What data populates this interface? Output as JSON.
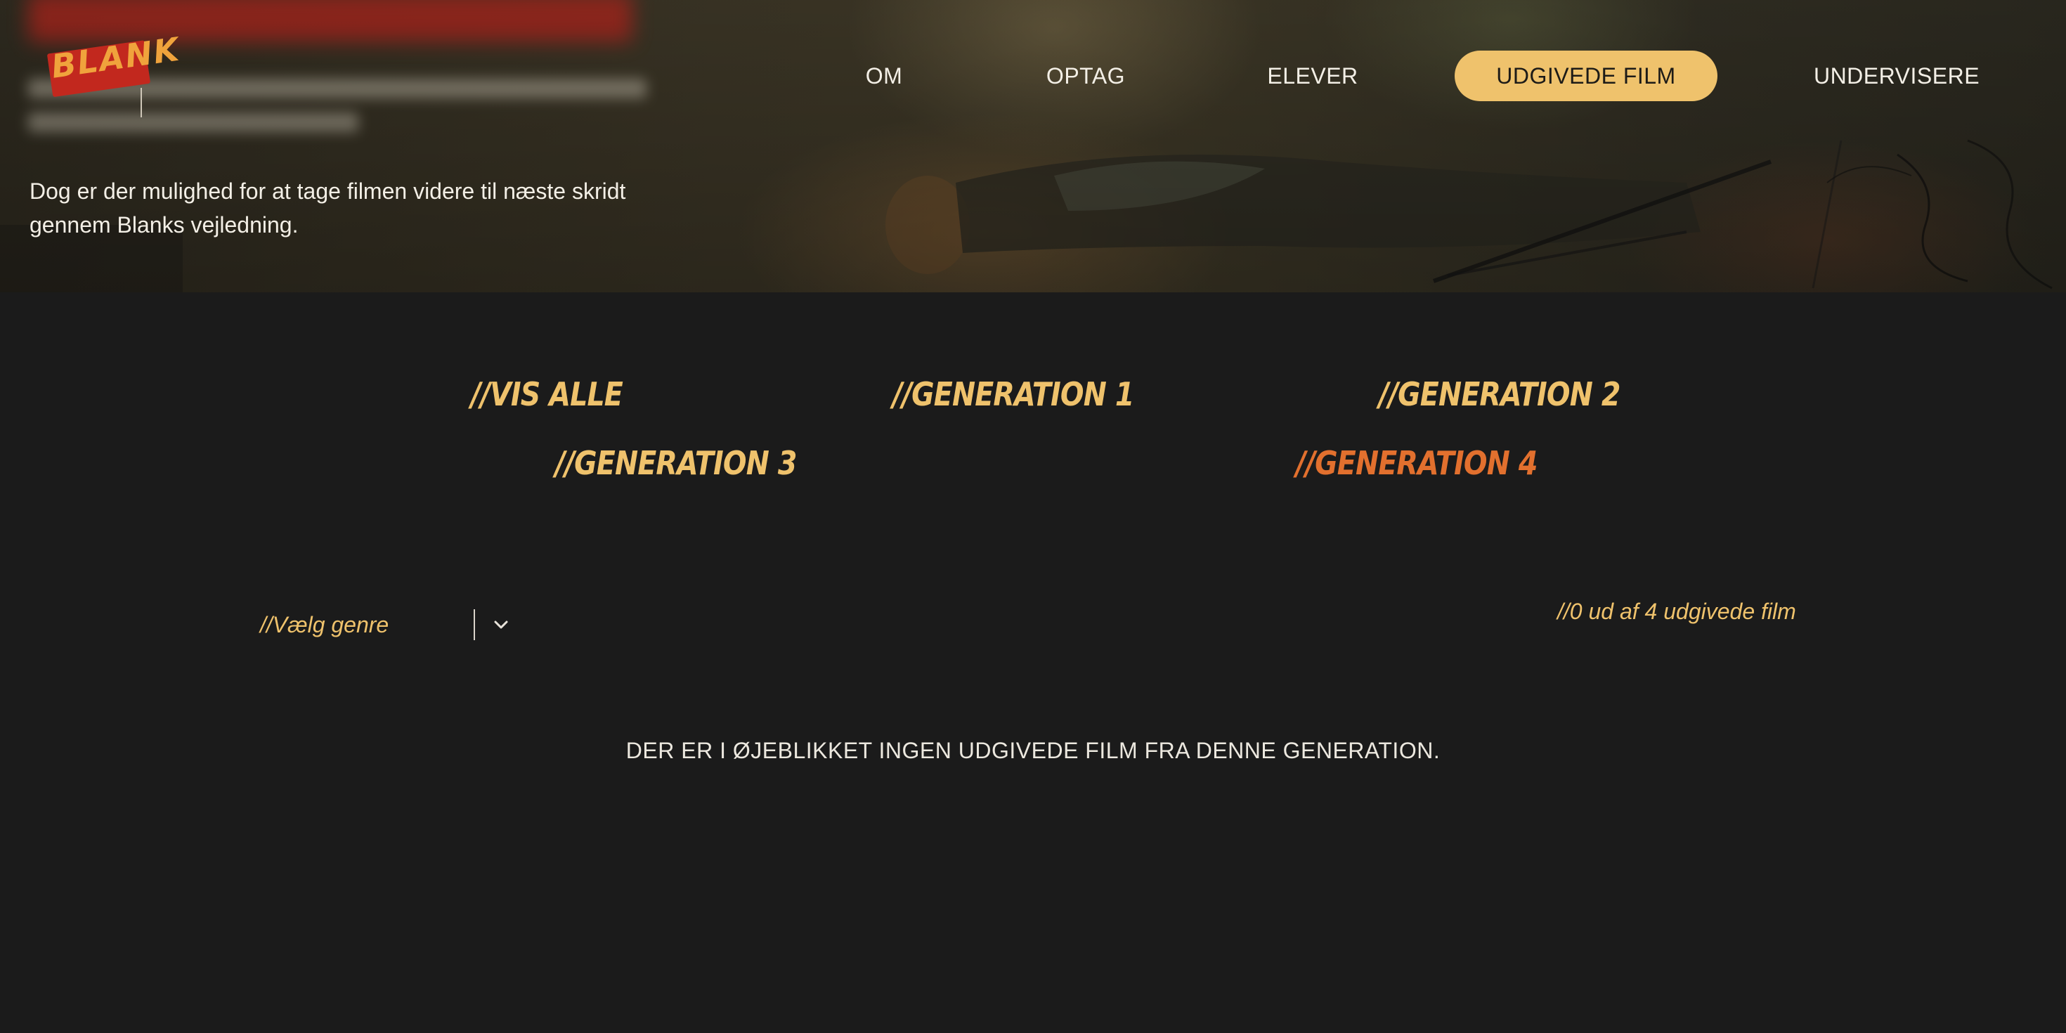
{
  "logo": {
    "text": "BLANK"
  },
  "hero": {
    "text": "Dog er der mulighed for at tage filmen videre til næste skridt gennem Blanks vejledning."
  },
  "nav": {
    "items": [
      {
        "label": "OM"
      },
      {
        "label": "OPTAG"
      },
      {
        "label": "ELEVER"
      },
      {
        "label": "UDGIVEDE FILM",
        "active": true
      },
      {
        "label": "UNDERVISERE"
      }
    ]
  },
  "generations": {
    "items": [
      {
        "label": "//VIS ALLE"
      },
      {
        "label": "//GENERATION 1"
      },
      {
        "label": "//GENERATION 2"
      },
      {
        "label": "//GENERATION 3"
      },
      {
        "label": "//GENERATION 4",
        "selected": true
      }
    ]
  },
  "filter": {
    "genre_label": "//Vælg genre",
    "count_text": "//0 ud af 4 udgivede film"
  },
  "main": {
    "empty_message": "DER ER I ØJEBLIKKET INGEN UDGIVEDE FILM FRA DENNE GENERATION."
  },
  "colors": {
    "accent": "#efc26c",
    "selected": "#e2702e",
    "background": "#1b1b1b",
    "logo_red": "#c2281e"
  },
  "icons": {
    "dropdown": "chevron-down-icon"
  }
}
